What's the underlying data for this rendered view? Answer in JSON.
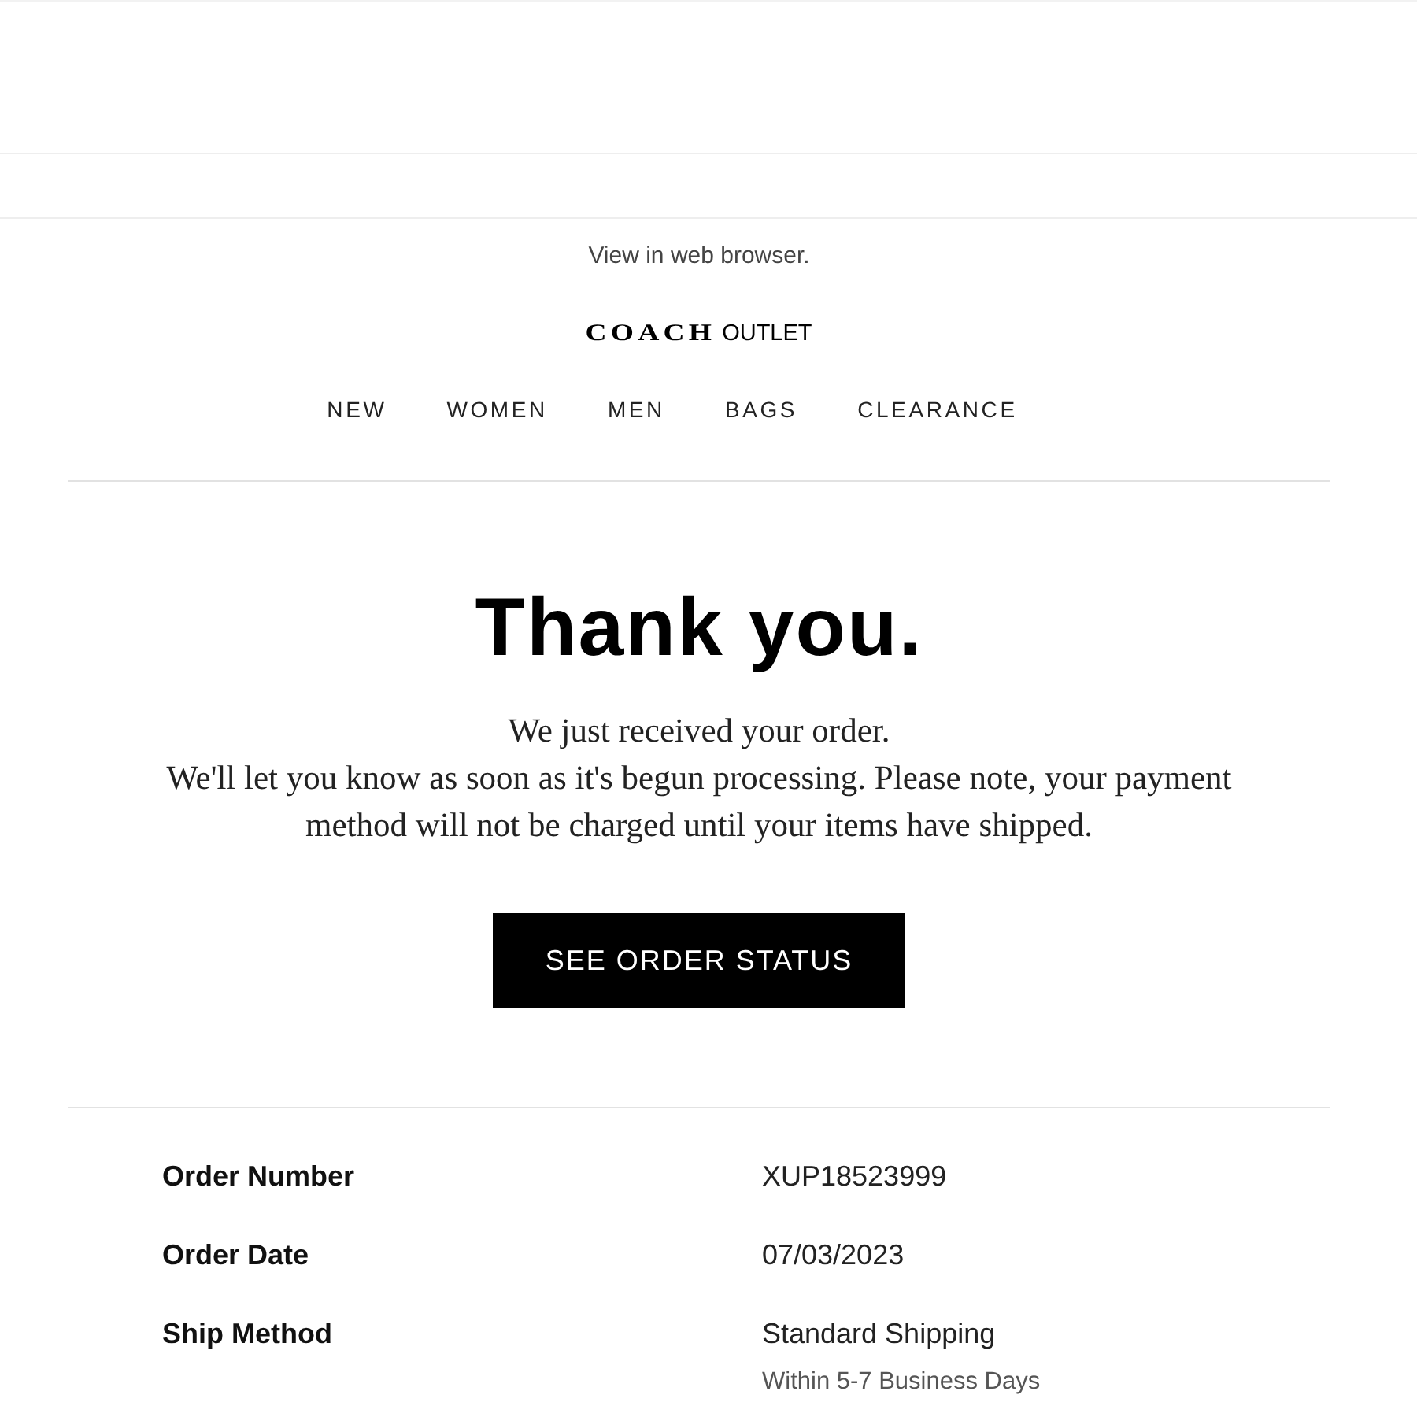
{
  "header": {
    "view_link": "View in web browser.",
    "logo": {
      "brand": "COACH",
      "suffix": "OUTLET"
    },
    "nav": [
      "NEW",
      "WOMEN",
      "MEN",
      "BAGS",
      "CLEARANCE"
    ]
  },
  "confirmation": {
    "heading": "Thank you.",
    "lines": [
      "We just received your order.",
      "We'll let you know as soon as it's begun processing. Please note, your payment method will not be charged until your items have shipped."
    ],
    "button": "SEE ORDER STATUS"
  },
  "order_details": [
    {
      "label": "Order Number",
      "value": "XUP18523999"
    },
    {
      "label": "Order Date",
      "value": "07/03/2023"
    },
    {
      "label": "Ship Method",
      "value": "Standard Shipping",
      "note": "Within 5-7 Business Days"
    }
  ]
}
